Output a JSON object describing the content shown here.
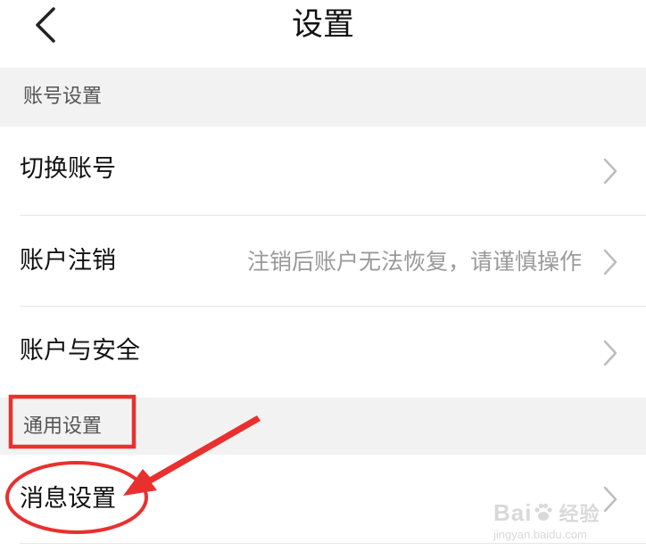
{
  "header": {
    "title": "设置",
    "back_icon": "chevron-left-icon"
  },
  "sections": [
    {
      "title": "账号设置",
      "items": [
        {
          "label": "切换账号",
          "hint": ""
        },
        {
          "label": "账户注销",
          "hint": "注销后账户无法恢复，请谨慎操作"
        },
        {
          "label": "账户与安全",
          "hint": ""
        }
      ]
    },
    {
      "title": "通用设置",
      "items": [
        {
          "label": "消息设置",
          "hint": ""
        }
      ]
    }
  ],
  "annotation": {
    "color": "#e8312f",
    "highlighted_section": "通用设置",
    "highlighted_item": "消息设置"
  },
  "watermark": {
    "brand": "Bai",
    "brand_suffix": "经验",
    "url": "jingyan.baidu.com"
  }
}
